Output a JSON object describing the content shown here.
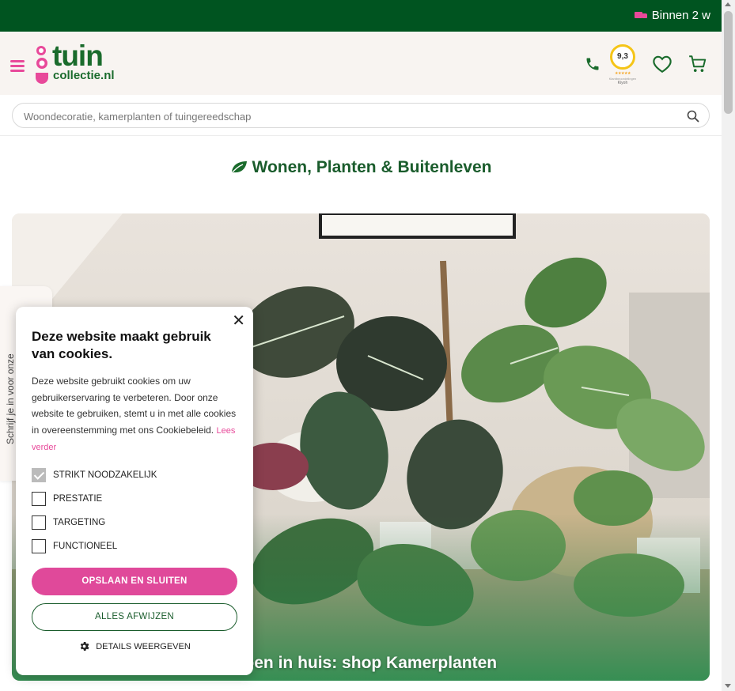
{
  "topbar": {
    "message": "Binnen 2 w",
    "icon": "truck-icon"
  },
  "header": {
    "logo": {
      "main": "tuin",
      "sub": "collectie.nl"
    },
    "kiyoh": {
      "score": "9,3",
      "stars": "★★★★★",
      "small_text": "Klantbeoordelingen",
      "name": "Kiyoh"
    },
    "icons": [
      "menu-icon",
      "phone-icon",
      "heart-icon",
      "cart-icon"
    ]
  },
  "search": {
    "placeholder": "Woondecoratie, kamerplanten of tuingereedschap"
  },
  "main": {
    "headline": "Wonen, Planten & Buitenleven",
    "hero_caption": "Groen in huis: shop Kamerplanten"
  },
  "sidetab": {
    "label": "Schrijf je in voor onze"
  },
  "cookie": {
    "title": "Deze website maakt gebruik van cookies.",
    "text": "Deze website gebruikt cookies om uw gebruikerservaring te verbeteren. Door onze website te gebruiken, stemt u in met alle cookies in overeenstemming met ons Cookiebeleid.",
    "link": "Lees verder",
    "close": "✕",
    "options": [
      {
        "label": "STRIKT NOODZAKELIJK",
        "checked": true
      },
      {
        "label": "PRESTATIE",
        "checked": false
      },
      {
        "label": "TARGETING",
        "checked": false
      },
      {
        "label": "FUNCTIONEEL",
        "checked": false
      }
    ],
    "save_button": "OPSLAAN EN SLUITEN",
    "reject_button": "ALLES AFWIJZEN",
    "details_button": "DETAILS WEERGEVEN"
  },
  "colors": {
    "green_dark": "#005420",
    "pink": "#e8499a",
    "green_text": "#1a5c2c"
  }
}
